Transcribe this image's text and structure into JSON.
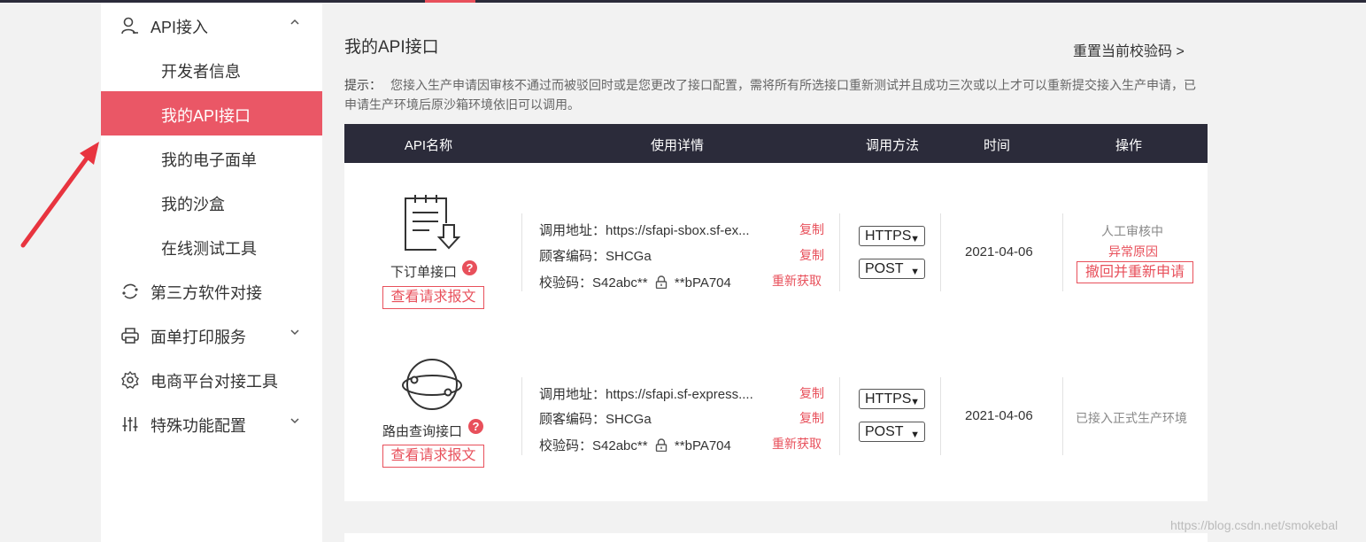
{
  "sidebar": {
    "api_section": {
      "label": "API接入",
      "icon": "user-icon",
      "expanded": true
    },
    "sub_items": [
      {
        "label": "开发者信息",
        "active": false
      },
      {
        "label": "我的API接口",
        "active": true
      },
      {
        "label": "我的电子面单",
        "active": false
      },
      {
        "label": "我的沙盒",
        "active": false
      },
      {
        "label": "在线测试工具",
        "active": false
      }
    ],
    "sections": [
      {
        "label": "第三方软件对接",
        "icon": "loop-icon"
      },
      {
        "label": "面单打印服务",
        "icon": "printer-icon"
      },
      {
        "label": "电商平台对接工具",
        "icon": "gear-icon"
      },
      {
        "label": "特殊功能配置",
        "icon": "sliders-icon"
      }
    ]
  },
  "main": {
    "title": "我的API接口",
    "reset_link": "重置当前校验码 >",
    "tip_label": "提示：",
    "tip_text": "您接入生产申请因审核不通过而被驳回时或是您更改了接口配置，需将所有所选接口重新测试并且成功三次或以上才可以重新提交接入生产申请，已申请生产环境后原沙箱环境依旧可以调用。"
  },
  "table": {
    "headers": [
      "API名称",
      "使用详情",
      "调用方法",
      "时间",
      "操作"
    ],
    "rows": [
      {
        "name": "下订单接口",
        "icon": "order-form-icon",
        "view_request": "查看请求报文",
        "url_label": "调用地址：",
        "url": "https://sfapi-sbox.sf-ex...",
        "customer_label": "顾客编码：",
        "customer": "SHCGa",
        "check_label": "校验码：",
        "check_prefix": "S42abc**",
        "check_suffix": "**bPA704",
        "copy": "复制",
        "refresh": "重新获取",
        "protocol": "HTTPS",
        "method": "POST",
        "date": "2021-04-06",
        "status": "人工审核中",
        "reason": "异常原因",
        "withdraw": "撤回并重新申请"
      },
      {
        "name": "路由查询接口",
        "icon": "globe-route-icon",
        "view_request": "查看请求报文",
        "url_label": "调用地址：",
        "url": "https://sfapi.sf-express....",
        "customer_label": "顾客编码：",
        "customer": "SHCGa",
        "check_label": "校验码：",
        "check_prefix": "S42abc**",
        "check_suffix": "**bPA704",
        "copy": "复制",
        "refresh": "重新获取",
        "protocol": "HTTPS",
        "method": "POST",
        "date": "2021-04-06",
        "status": "已接入正式生产环境"
      }
    ]
  },
  "watermark": "https://blog.csdn.net/smokebal",
  "colors": {
    "accent": "#e8505b",
    "header_bg": "#2b2b3a",
    "active_nav": "#ea5766"
  }
}
